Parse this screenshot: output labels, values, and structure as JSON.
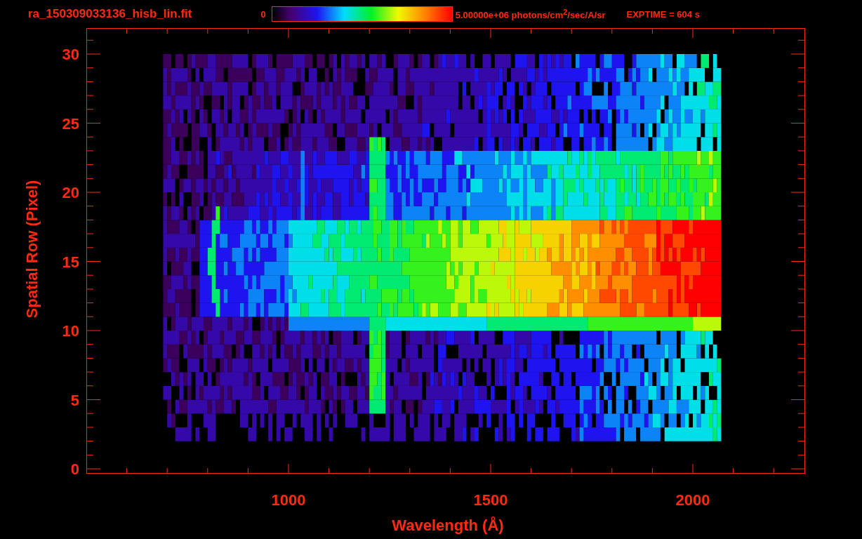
{
  "title": "ra_150309033136_hisb_lin.fit",
  "colorbar": {
    "min_label": "0",
    "max_label": "5.00000e+06 photons/cm$^{2}$/sec/A/sr"
  },
  "exposure": "EXPTIME = 604 s",
  "y_axis": {
    "label": "Spatial Row (Pixel)",
    "ticks": [
      "30",
      "25",
      "20",
      "15",
      "10",
      "5",
      "0"
    ]
  },
  "x_axis": {
    "label": "Wavelength (Å)",
    "ticks": [
      "1000",
      "1500",
      "2000"
    ]
  }
}
